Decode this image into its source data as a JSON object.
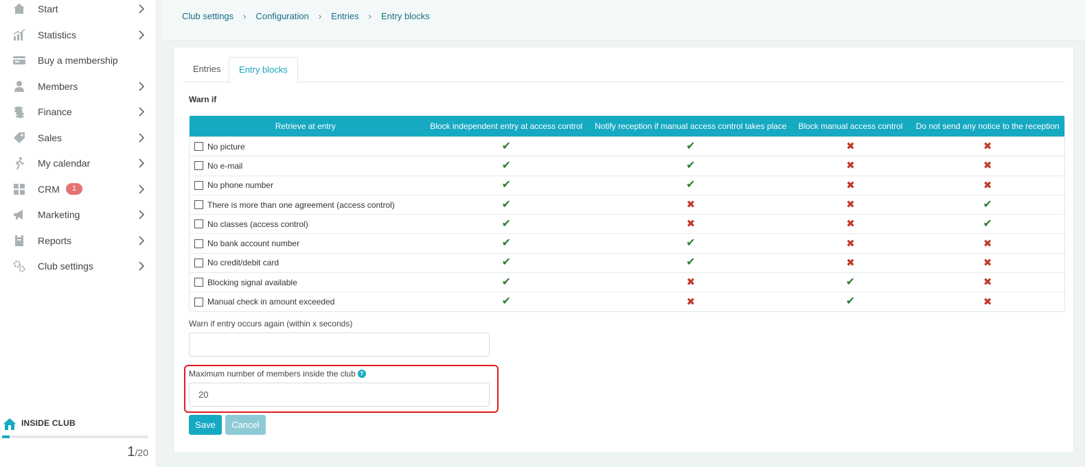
{
  "sidebar": {
    "items": [
      {
        "label": "Start",
        "icon": "home-icon",
        "has_chevron": true
      },
      {
        "label": "Statistics",
        "icon": "chart-icon",
        "has_chevron": true
      },
      {
        "label": "Buy a membership",
        "icon": "card-icon",
        "has_chevron": false
      },
      {
        "label": "Members",
        "icon": "person-icon",
        "has_chevron": true
      },
      {
        "label": "Finance",
        "icon": "coins-icon",
        "has_chevron": true
      },
      {
        "label": "Sales",
        "icon": "tag-icon",
        "has_chevron": true
      },
      {
        "label": "My calendar",
        "icon": "runner-icon",
        "has_chevron": true
      },
      {
        "label": "CRM",
        "icon": "grid-icon",
        "has_chevron": true,
        "badge": "1"
      },
      {
        "label": "Marketing",
        "icon": "megaphone-icon",
        "has_chevron": true
      },
      {
        "label": "Reports",
        "icon": "report-icon",
        "has_chevron": true
      },
      {
        "label": "Club settings",
        "icon": "gear-icon",
        "has_chevron": true
      }
    ],
    "inside_club": {
      "label": "INSIDE CLUB",
      "current": "1",
      "max": "/20",
      "progress": 0.05
    }
  },
  "breadcrumb": [
    "Club settings",
    "Configuration",
    "Entries",
    "Entry blocks"
  ],
  "tabs": [
    {
      "label": "Entries",
      "active": false
    },
    {
      "label": "Entry blocks",
      "active": true
    }
  ],
  "warn_title": "Warn if",
  "table": {
    "headers": [
      "Retrieve at entry",
      "Block independent entry at access control",
      "Notify reception if manual access control takes place",
      "Block manual access control",
      "Do not send any notice to the reception"
    ],
    "rows": [
      {
        "label": "No picture",
        "values": [
          true,
          true,
          false,
          false
        ]
      },
      {
        "label": "No e-mail",
        "values": [
          true,
          true,
          false,
          false
        ]
      },
      {
        "label": "No phone number",
        "values": [
          true,
          true,
          false,
          false
        ]
      },
      {
        "label": "There is more than one agreement (access control)",
        "values": [
          true,
          false,
          false,
          true
        ]
      },
      {
        "label": "No classes (access control)",
        "values": [
          true,
          false,
          false,
          true
        ]
      },
      {
        "label": "No bank account number",
        "values": [
          true,
          true,
          false,
          false
        ]
      },
      {
        "label": "No credit/debit card",
        "values": [
          true,
          true,
          false,
          false
        ]
      },
      {
        "label": "Blocking signal available",
        "values": [
          true,
          false,
          true,
          false
        ]
      },
      {
        "label": "Manual check in amount exceeded",
        "values": [
          true,
          false,
          true,
          false
        ]
      }
    ]
  },
  "repeat_field": {
    "label": "Warn if entry occurs again (within x seconds)",
    "value": ""
  },
  "max_field": {
    "label": "Maximum number of members inside the club",
    "help": "?",
    "value": "20"
  },
  "buttons": {
    "save": "Save",
    "cancel": "Cancel"
  },
  "colors": {
    "accent": "#16a9c2",
    "check": "#2e7d32",
    "cross": "#c0392b",
    "highlight": "#e21b1b"
  }
}
